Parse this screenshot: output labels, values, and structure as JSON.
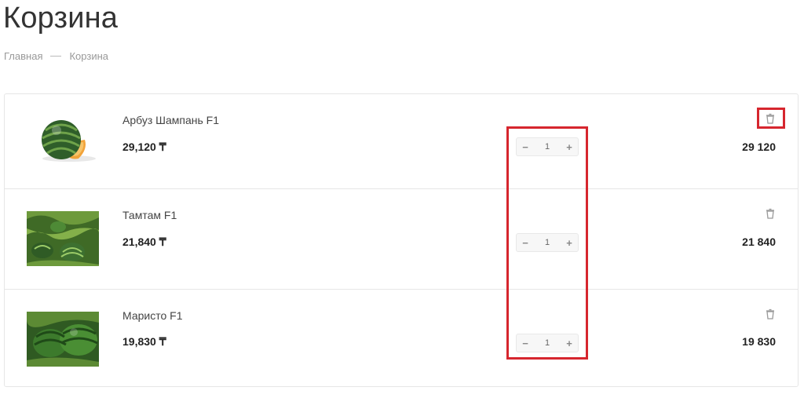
{
  "page": {
    "title": "Корзина",
    "breadcrumb": [
      "Главная",
      "Корзина"
    ]
  },
  "currency_sign": "₸",
  "cart": {
    "items": [
      {
        "name": "Арбуз Шампань F1",
        "price": "29,120 ₸",
        "quantity": "1",
        "total": "29 120",
        "decrement": "−",
        "increment": "+"
      },
      {
        "name": "Тамтам F1",
        "price": "21,840 ₸",
        "quantity": "1",
        "total": "21 840",
        "decrement": "−",
        "increment": "+"
      },
      {
        "name": "Маристо F1",
        "price": "19,830 ₸",
        "quantity": "1",
        "total": "19 830",
        "decrement": "−",
        "increment": "+"
      }
    ]
  },
  "icons": {
    "delete": "trash-icon"
  },
  "colors": {
    "highlight": "#d6262e",
    "border": "#e6e6e6",
    "text": "#333333",
    "muted": "#999999"
  }
}
